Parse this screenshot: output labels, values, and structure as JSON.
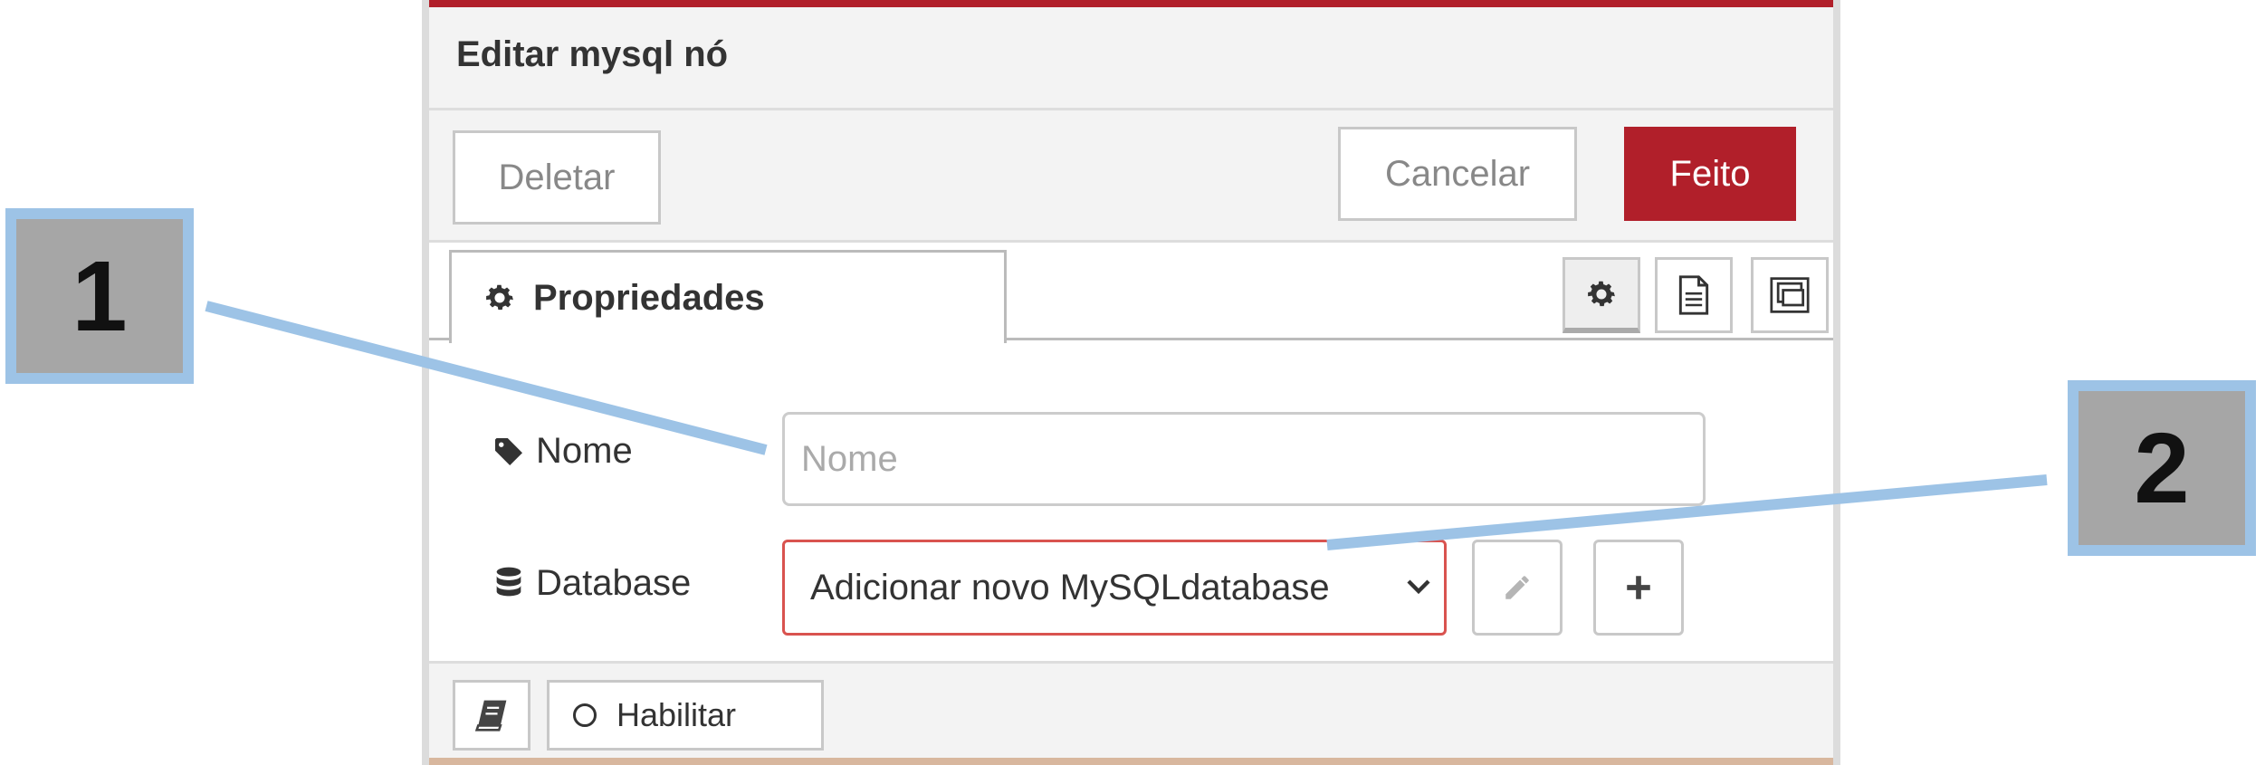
{
  "dialog": {
    "title": "Editar mysql nó",
    "buttons": {
      "delete": "Deletar",
      "cancel": "Cancelar",
      "done": "Feito"
    },
    "tabs": {
      "properties": "Propriedades",
      "icon_tabs": [
        "gear-icon",
        "description-icon",
        "appearance-icon"
      ]
    },
    "form": {
      "name": {
        "label": "Nome",
        "placeholder": "Nome",
        "value": ""
      },
      "database": {
        "label": "Database",
        "selected": "Adicionar novo MySQLdatabase"
      }
    },
    "footer": {
      "enable": "Habilitar"
    }
  },
  "callouts": [
    "1",
    "2"
  ],
  "colors": {
    "accent": "#b11f2a",
    "error_border": "#d9534f",
    "callout_fill": "#a6a6a6",
    "callout_border": "#9dc3e6"
  }
}
